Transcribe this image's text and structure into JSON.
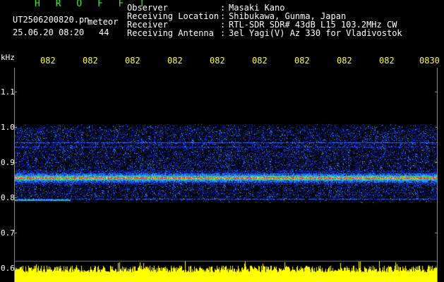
{
  "header": {
    "brand": "H R O F F T",
    "filename": "UT2506200820.pn",
    "meteor_label": "meteor",
    "datetime": "25.06.20 08:20",
    "count": "44"
  },
  "info": [
    {
      "label": "Observer",
      "sep": ":",
      "value": "Masaki Kano"
    },
    {
      "label": "Receiving Location",
      "sep": ":",
      "value": "Shibukawa, Gunma, Japan"
    },
    {
      "label": "Receiver",
      "sep": ":",
      "value": "RTL-SDR SDR# 43dB L15 103.2MHz CW"
    },
    {
      "label": "Receiving Antenna",
      "sep": ":",
      "value": "3el Yagi(V) Az 330 for Vladivostok"
    }
  ],
  "axis": {
    "unit": "kHz",
    "y_ticks": [
      "1.1",
      "1.0",
      "0.9",
      "0.8",
      "0.7",
      "0.6"
    ],
    "time_ticks": [
      "082",
      "082",
      "082",
      "082",
      "082",
      "082",
      "082",
      "082",
      "082",
      "0830"
    ]
  },
  "colors": {
    "background": "#000000",
    "text": "#ffffff",
    "brand": "#33ee33",
    "ticks": "#ffff33",
    "signal_band": "#ff3b1f",
    "noise_low": "#0a1a8a",
    "noise_high": "#1e90ff",
    "amplitude": "#ffff00"
  }
}
